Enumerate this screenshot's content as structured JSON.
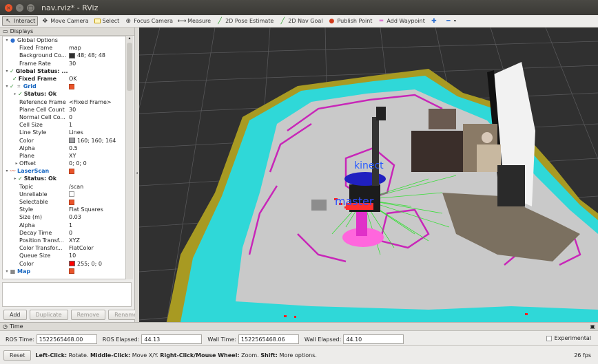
{
  "window": {
    "title": "nav.rviz* - RViz"
  },
  "toolbar": {
    "items": [
      {
        "label": "Interact"
      },
      {
        "label": "Move Camera"
      },
      {
        "label": "Select"
      },
      {
        "label": "Focus Camera"
      },
      {
        "label": "Measure"
      },
      {
        "label": "2D Pose Estimate"
      },
      {
        "label": "2D Nav Goal"
      },
      {
        "label": "Publish Point"
      },
      {
        "label": "Add Waypoint"
      }
    ]
  },
  "displays": {
    "header": "Displays",
    "rows": [
      {
        "name": "Global Options",
        "value": ""
      },
      {
        "name": "Fixed Frame",
        "value": "map"
      },
      {
        "name": "Background Co...",
        "value": "48; 48; 48"
      },
      {
        "name": "Frame Rate",
        "value": "30"
      },
      {
        "name": "Global Status: ...",
        "value": ""
      },
      {
        "name": "Fixed Frame",
        "value": "OK"
      },
      {
        "name": "Grid",
        "value": ""
      },
      {
        "name": "Status: Ok",
        "value": ""
      },
      {
        "name": "Reference Frame",
        "value": "<Fixed Frame>"
      },
      {
        "name": "Plane Cell Count",
        "value": "30"
      },
      {
        "name": "Normal Cell Co...",
        "value": "0"
      },
      {
        "name": "Cell Size",
        "value": "1"
      },
      {
        "name": "Line Style",
        "value": "Lines"
      },
      {
        "name": "Color",
        "value": "160; 160; 164"
      },
      {
        "name": "Alpha",
        "value": "0.5"
      },
      {
        "name": "Plane",
        "value": "XY"
      },
      {
        "name": "Offset",
        "value": "0; 0; 0"
      },
      {
        "name": "LaserScan",
        "value": ""
      },
      {
        "name": "Status: Ok",
        "value": ""
      },
      {
        "name": "Topic",
        "value": "/scan"
      },
      {
        "name": "Unreliable",
        "value": ""
      },
      {
        "name": "Selectable",
        "value": ""
      },
      {
        "name": "Style",
        "value": "Flat Squares"
      },
      {
        "name": "Size (m)",
        "value": "0.03"
      },
      {
        "name": "Alpha",
        "value": "1"
      },
      {
        "name": "Decay Time",
        "value": "0"
      },
      {
        "name": "Position Transf...",
        "value": "XYZ"
      },
      {
        "name": "Color Transfor...",
        "value": "FlatColor"
      },
      {
        "name": "Queue Size",
        "value": "10"
      },
      {
        "name": "Color",
        "value": "255; 0; 0"
      },
      {
        "name": "Map",
        "value": ""
      }
    ],
    "buttons": {
      "add": "Add",
      "duplicate": "Duplicate",
      "remove": "Remove",
      "rename": "Rename"
    }
  },
  "view": {
    "labels": {
      "kinect": "kinect",
      "master": "master"
    }
  },
  "time": {
    "header": "Time",
    "ros_time_label": "ROS Time:",
    "ros_time": "1522565468.00",
    "ros_elapsed_label": "ROS Elapsed:",
    "ros_elapsed": "44.13",
    "wall_time_label": "Wall Time:",
    "wall_time": "1522565468.06",
    "wall_elapsed_label": "Wall Elapsed:",
    "wall_elapsed": "44.10",
    "experimental": "Experimental"
  },
  "status": {
    "reset": "Reset",
    "left_key": "Left-Click:",
    "left_text": " Rotate. ",
    "middle_key": "Middle-Click:",
    "middle_text": " Move X/Y. ",
    "right_key": "Right-Click/Mouse Wheel:",
    "right_text": " Zoom. ",
    "shift_key": "Shift:",
    "shift_text": " More options.",
    "fps": "26 fps"
  },
  "colors": {
    "background": "#303030",
    "grid": "#a0a0a4",
    "laser": "#ff0000",
    "map_free": "#c8c8c8",
    "map_cyan": "#2fd8d8",
    "map_magenta": "#d020c0",
    "map_olive": "#b0a020"
  }
}
